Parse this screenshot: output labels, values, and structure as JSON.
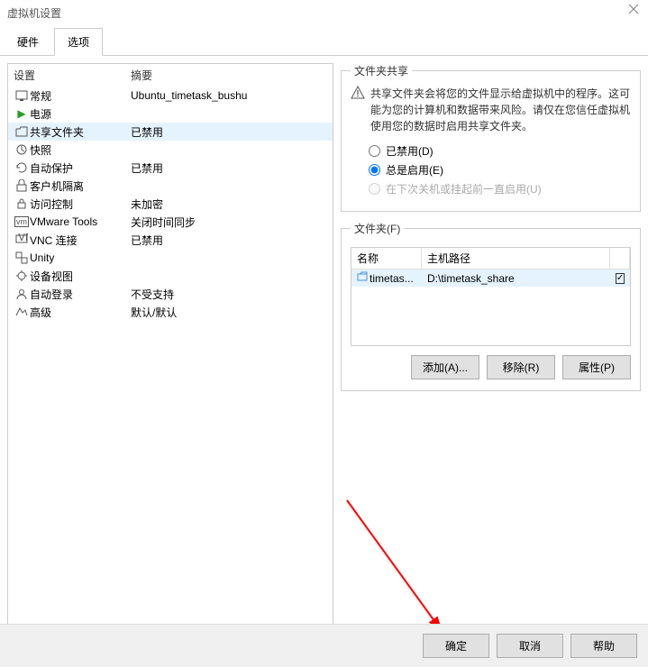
{
  "window": {
    "title": "虚拟机设置"
  },
  "tabs": {
    "hardware": "硬件",
    "options": "选项"
  },
  "list": {
    "header": {
      "setting": "设置",
      "summary": "摘要"
    },
    "items": [
      {
        "name": "general",
        "label": "常规",
        "summary": "Ubuntu_timetask_bushu"
      },
      {
        "name": "power",
        "label": "电源",
        "summary": ""
      },
      {
        "name": "shared-folders",
        "label": "共享文件夹",
        "summary": "已禁用",
        "selected": true
      },
      {
        "name": "snapshots",
        "label": "快照",
        "summary": ""
      },
      {
        "name": "autoprotect",
        "label": "自动保护",
        "summary": "已禁用"
      },
      {
        "name": "guest-isolation",
        "label": "客户机隔离",
        "summary": ""
      },
      {
        "name": "access-control",
        "label": "访问控制",
        "summary": "未加密"
      },
      {
        "name": "vmware-tools",
        "label": "VMware Tools",
        "summary": "关闭时间同步"
      },
      {
        "name": "vnc",
        "label": "VNC 连接",
        "summary": "已禁用"
      },
      {
        "name": "unity",
        "label": "Unity",
        "summary": ""
      },
      {
        "name": "appliance-view",
        "label": "设备视图",
        "summary": ""
      },
      {
        "name": "autologin",
        "label": "自动登录",
        "summary": "不受支持"
      },
      {
        "name": "advanced",
        "label": "高级",
        "summary": "默认/默认"
      }
    ]
  },
  "share": {
    "legend": "文件夹共享",
    "warning": "共享文件夹会将您的文件显示给虚拟机中的程序。这可能为您的计算机和数据带来风险。请仅在您信任虚拟机使用您的数据时启用共享文件夹。",
    "opt_disabled": "已禁用(D)",
    "opt_always": "总是启用(E)",
    "opt_until": "在下次关机或挂起前一直启用(U)"
  },
  "folders": {
    "legend": "文件夹(F)",
    "col_name": "名称",
    "col_host": "主机路径",
    "row_name": "timetas...",
    "row_path": "D:\\timetask_share",
    "btn_add": "添加(A)...",
    "btn_remove": "移除(R)",
    "btn_props": "属性(P)"
  },
  "footer": {
    "ok": "确定",
    "cancel": "取消",
    "help": "帮助"
  }
}
